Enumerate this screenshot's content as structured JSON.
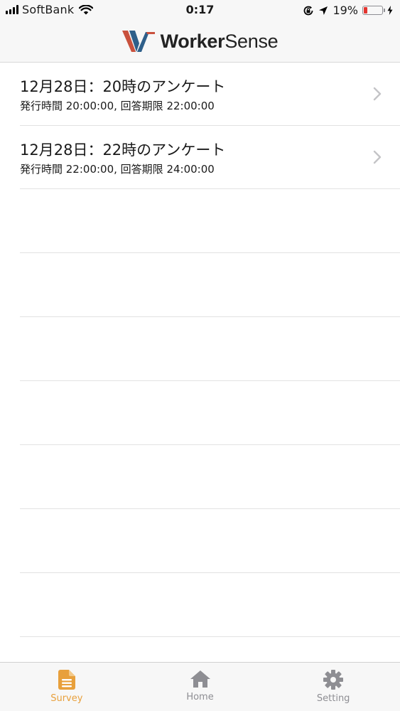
{
  "status_bar": {
    "carrier": "SoftBank",
    "time": "0:17",
    "battery_percent": "19%",
    "battery_level": 0.19,
    "battery_color": "#e3342f"
  },
  "header": {
    "brand_bold": "Worker",
    "brand_light": "Sense",
    "logo_icon": "workersense-logo-icon"
  },
  "surveys": [
    {
      "title": "12月28日：20時のアンケート",
      "subtitle": "発行時間 20:00:00, 回答期限 22:00:00"
    },
    {
      "title": "12月28日：22時のアンケート",
      "subtitle": "発行時間 22:00:00, 回答期限 24:00:00"
    }
  ],
  "tabs": [
    {
      "label": "Survey",
      "icon": "document-icon",
      "active": true
    },
    {
      "label": "Home",
      "icon": "home-icon",
      "active": false
    },
    {
      "label": "Setting",
      "icon": "gear-icon",
      "active": false
    }
  ],
  "colors": {
    "accent": "#e8a03c",
    "inactive": "#8e8e93"
  }
}
